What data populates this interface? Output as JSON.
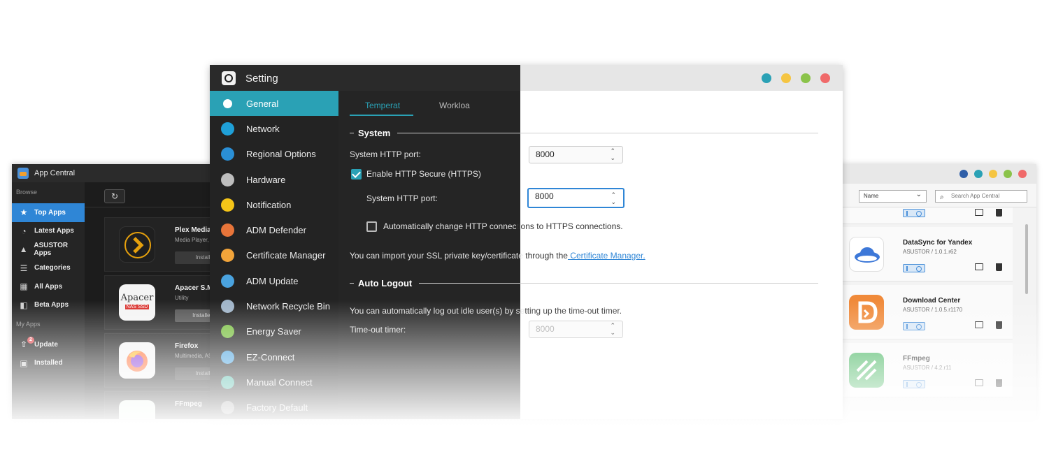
{
  "app_central_left": {
    "title": "App Central",
    "browse_label": "Browse",
    "browse_items": [
      {
        "label": "Top Apps",
        "icon": "star-icon",
        "active": true
      },
      {
        "label": "Latest Apps",
        "icon": "clock-icon"
      },
      {
        "label": "ASUSTOR Apps",
        "icon": "asustor-logo-icon"
      },
      {
        "label": "Categories",
        "icon": "list-icon"
      },
      {
        "label": "All Apps",
        "icon": "grid-icon"
      },
      {
        "label": "Beta Apps",
        "icon": "beta-icon"
      }
    ],
    "myapps_label": "My Apps",
    "myapps_items": [
      {
        "label": "Update",
        "icon": "update-icon",
        "badge": "2"
      },
      {
        "label": "Installed",
        "icon": "installed-icon"
      }
    ],
    "refresh_icon": "↻",
    "apps": [
      {
        "name": "Plex Media Se",
        "sub": "Media Player, Me",
        "button": "Install",
        "icon": "plex-icon",
        "color": "#e5a00d"
      },
      {
        "name": "Apacer S.M.A",
        "sub": "Utility",
        "button": "Installed",
        "icon": "apacer-icon",
        "logo_text": "Apacer",
        "logo_sub": "NAS SSD"
      },
      {
        "name": "Firefox",
        "sub": "Multimedia, ASUS",
        "button": "Install",
        "icon": "firefox-icon",
        "color": "#ff7139"
      },
      {
        "name": "FFmpeg",
        "sub": "",
        "button": "",
        "icon": "ffmpeg-icon",
        "color": "#4caf50"
      }
    ]
  },
  "app_central_right": {
    "sort_select": "Name",
    "search_placeholder": "Search App Central",
    "apps": [
      {
        "name": "DataSync for Yandex",
        "version": "ASUSTOR / 1.0.1.r62",
        "icon": "yandex-disk-icon",
        "color": "#ffffff"
      },
      {
        "name": "Download Center",
        "version": "ASUSTOR / 1.0.5.r1170",
        "icon": "download-center-icon",
        "color": "#f08a3a"
      },
      {
        "name": "FFmpeg",
        "version": "ASUSTOR / 4.2.r11",
        "icon": "ffmpeg-icon",
        "color": "#3fb35a"
      }
    ]
  },
  "setting": {
    "title": "Setting",
    "nav": [
      {
        "label": "General",
        "icon": "general-icon",
        "color": "#2aa1b5",
        "active": true
      },
      {
        "label": "Network",
        "icon": "globe-icon",
        "color": "#1fa0d8"
      },
      {
        "label": "Regional Options",
        "icon": "regional-icon",
        "color": "#2a8fd6"
      },
      {
        "label": "Hardware",
        "icon": "hardware-icon",
        "color": "#bdbdbd"
      },
      {
        "label": "Notification",
        "icon": "notification-icon",
        "color": "#f5c518"
      },
      {
        "label": "ADM Defender",
        "icon": "firewall-icon",
        "color": "#e8753a"
      },
      {
        "label": "Certificate Manager",
        "icon": "certificate-icon",
        "color": "#f2a43a"
      },
      {
        "label": "ADM Update",
        "icon": "adm-update-icon",
        "color": "#4aa3df"
      },
      {
        "label": "Network Recycle Bin",
        "icon": "recycle-bin-icon",
        "color": "#9fb4c8"
      },
      {
        "label": "Energy Saver",
        "icon": "energy-icon",
        "color": "#7bc043"
      },
      {
        "label": "EZ-Connect",
        "icon": "cloud-icon",
        "color": "#4aa3df"
      },
      {
        "label": "Manual Connect",
        "icon": "manual-connect-icon",
        "color": "#3fb3a0"
      },
      {
        "label": "Factory Default",
        "icon": "factory-default-icon",
        "color": "#888888"
      }
    ],
    "tabs": [
      {
        "label": "Temperat",
        "active": true
      },
      {
        "label": "Workloa",
        "active": false
      }
    ],
    "system_section": "System",
    "http_port_label": "System HTTP port:",
    "http_port_value": "8000",
    "https_enable_label": "Enable HTTP Secure (HTTPS)",
    "https_enabled": true,
    "https_port_label": "System HTTP port:",
    "https_port_value": "8000",
    "auto_redirect_label": "Automatically change HTTP connections to HTTPS connections.",
    "auto_redirect_checked": false,
    "ssl_text": "You can import your SSL private key/certificate through the",
    "ssl_link": " Certificate Manager.",
    "autologout_section": "Auto Logout",
    "autologout_text": "You can automatically log out idle user(s) by setting up the time-out timer.",
    "timeout_label": "Time-out timer:",
    "timeout_value": "8000",
    "window_dots": [
      "#2aa1b5",
      "#f5c542",
      "#8bc34a",
      "#f06a6a"
    ]
  },
  "app_central_right_dots": [
    "#2f5fa8",
    "#2aa1b5",
    "#f5c542",
    "#8bc34a",
    "#f06a6a"
  ]
}
